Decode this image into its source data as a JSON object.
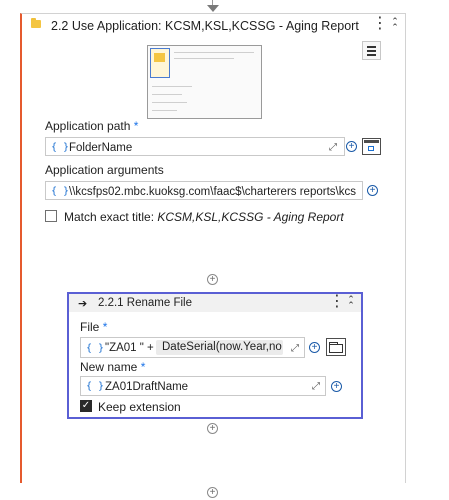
{
  "outer_activity": {
    "number": "2.2",
    "title": "Use Application: KCSM,KSL,KCSSG - Aging Report",
    "application_path": {
      "label": "Application path",
      "required_mark": "*",
      "value": "FolderName"
    },
    "application_arguments": {
      "label": "Application arguments",
      "value": "\\\\kcsfps02.mbc.kuoksg.com\\faac$\\charterers reports\\kcs ..."
    },
    "match_exact_title": {
      "label_prefix": "Match exact title: ",
      "value": "KCSM,KSL,KCSSG - Aging Report",
      "checked": false
    }
  },
  "inner_activity": {
    "number": "2.2.1",
    "title": "Rename File",
    "file": {
      "label": "File",
      "required_mark": "*",
      "value_part1": "\"ZA01 \" +",
      "value_part2": "DateSerial(now.Year,no..."
    },
    "new_name": {
      "label": "New name",
      "required_mark": "*",
      "value": "ZA01DraftName"
    },
    "keep_extension": {
      "label": "Keep extension",
      "checked": true
    }
  },
  "icons": {
    "braces": "{ }",
    "expand": "⤢",
    "kebab": "⋮",
    "collapse": "⌃⌃",
    "plus": "+",
    "arrow": "➔",
    "check": "✓"
  },
  "colors": {
    "accent_orange": "#e55a2e",
    "selection_border": "#5a5fd4",
    "link_blue": "#1a73e8"
  }
}
